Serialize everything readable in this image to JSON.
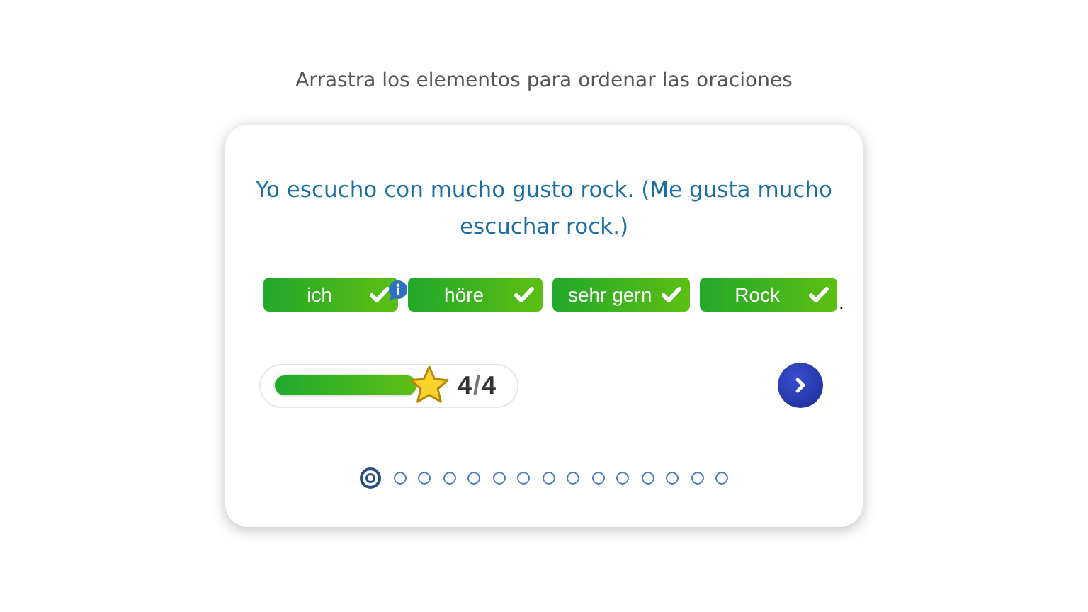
{
  "instruction": "Arrastra los elementos para ordenar las oraciones",
  "sentence": "Yo escucho con mucho gusto rock. (Me gusta mucho escuchar rock.)",
  "chips": [
    {
      "text": "ich",
      "correct": true,
      "info": true
    },
    {
      "text": "höre",
      "correct": true,
      "info": false
    },
    {
      "text": "sehr gern",
      "correct": true,
      "info": false
    },
    {
      "text": "Rock",
      "correct": true,
      "info": false
    }
  ],
  "punctuation": ".",
  "progress": {
    "level": 1,
    "score": "4",
    "separator": "/",
    "total": "4"
  },
  "pages": [
    {
      "selected": true
    },
    {
      "selected": false
    },
    {
      "selected": false
    },
    {
      "selected": false
    },
    {
      "selected": false
    },
    {
      "selected": false
    },
    {
      "selected": false
    },
    {
      "selected": false
    },
    {
      "selected": false
    },
    {
      "selected": false
    },
    {
      "selected": false
    },
    {
      "selected": false
    },
    {
      "selected": false
    },
    {
      "selected": false
    },
    {
      "selected": false
    }
  ]
}
